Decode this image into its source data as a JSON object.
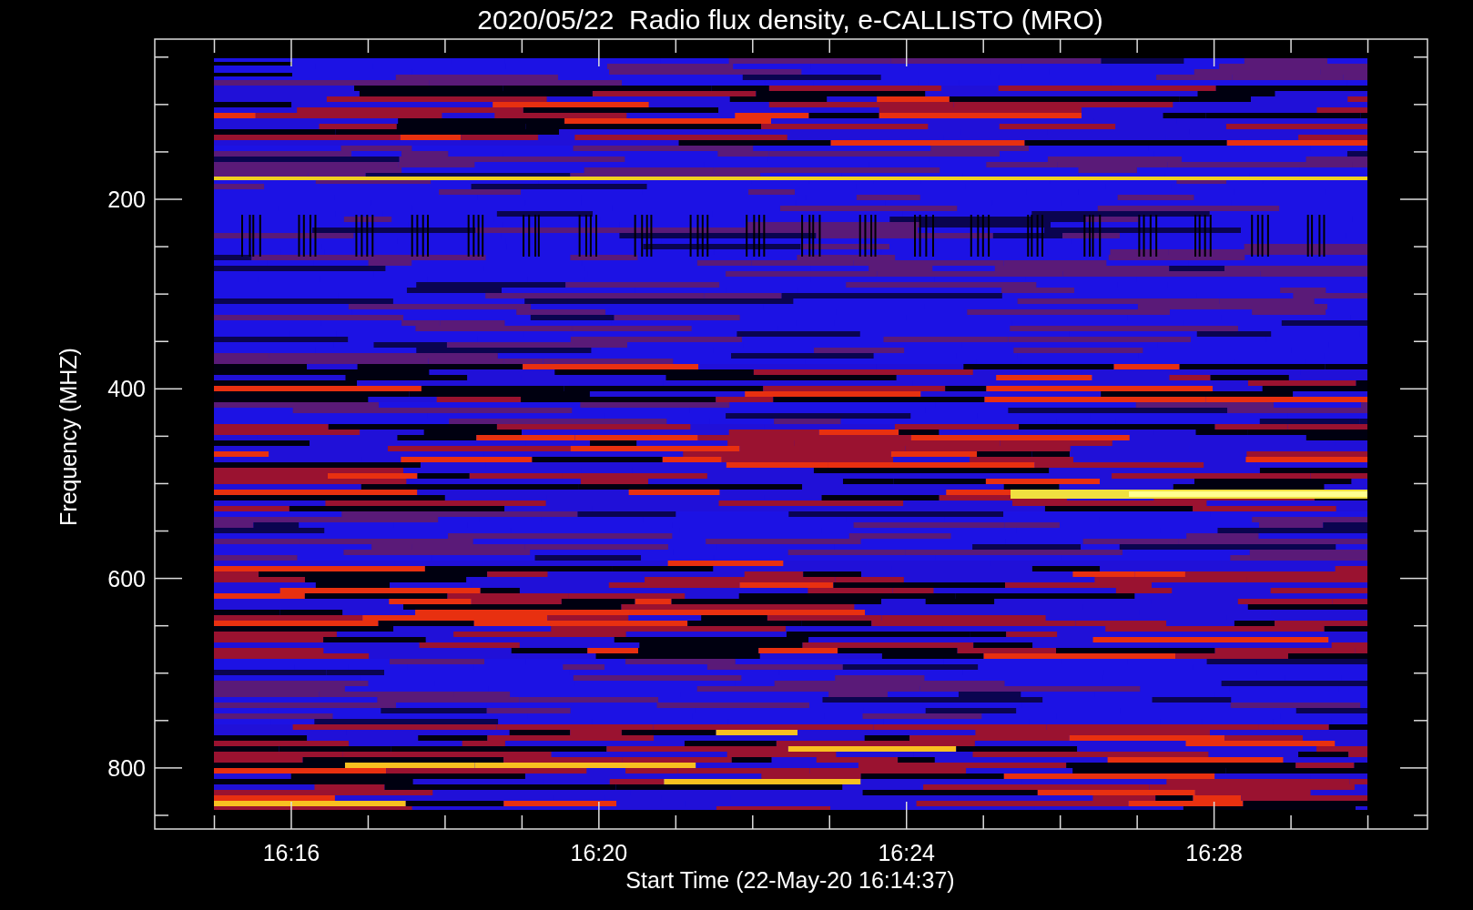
{
  "title": "2020/05/22  Radio flux density, e-CALLISTO (MRO)",
  "chart": {
    "ylabel": "Frequency (MHZ)",
    "xlabel": "Start Time (22-May-20 16:14:37)",
    "yticks": [
      "200",
      "400",
      "600",
      "800"
    ],
    "xticks": [
      "16:16",
      "16:20",
      "16:24",
      "16:28"
    ]
  }
}
